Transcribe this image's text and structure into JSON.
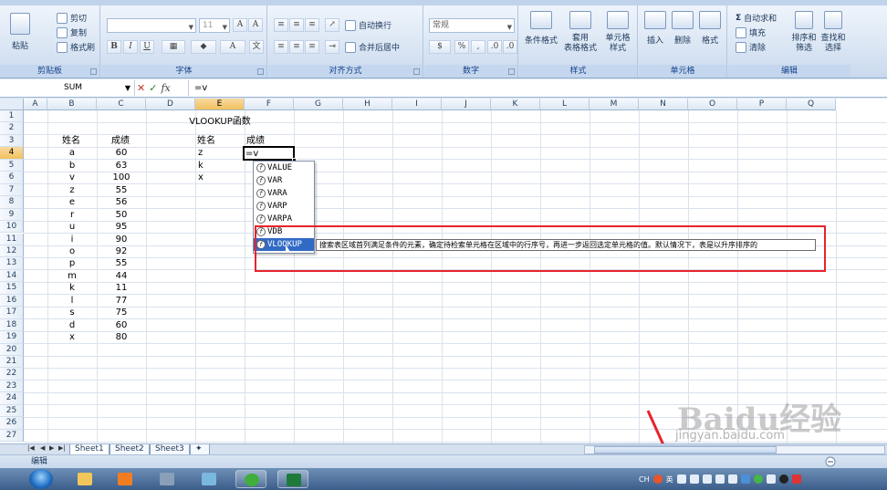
{
  "ribbon": {
    "clipboard": {
      "label": "剪贴板",
      "paste": "粘贴",
      "cut": "剪切",
      "copy": "复制",
      "format_painter": "格式刷"
    },
    "font": {
      "label": "字体",
      "size": "11",
      "bold": "B",
      "italic": "I",
      "underline": "U"
    },
    "alignment": {
      "label": "对齐方式",
      "wrap": "自动换行",
      "merge": "合并后居中"
    },
    "number": {
      "label": "数字",
      "format": "常规",
      "percent": "%"
    },
    "styles": {
      "label": "样式",
      "conditional": "条件格式",
      "table_format": "套用\n表格格式",
      "cell_styles": "单元格\n样式"
    },
    "cells": {
      "label": "单元格",
      "insert": "插入",
      "delete": "删除",
      "format": "格式"
    },
    "editing": {
      "label": "编辑",
      "autosum": "自动求和",
      "fill": "填充",
      "clear": "清除",
      "sort": "排序和\n筛选",
      "find": "查找和\n选择"
    }
  },
  "formula_bar": {
    "name_box": "SUM",
    "formula": "=v"
  },
  "columns": [
    "A",
    "B",
    "C",
    "D",
    "E",
    "F",
    "G",
    "H",
    "I",
    "J",
    "K",
    "L",
    "M",
    "N",
    "O",
    "P",
    "Q"
  ],
  "rows": [
    "1",
    "2",
    "3",
    "4",
    "5",
    "6",
    "7",
    "8",
    "9",
    "10",
    "11",
    "12",
    "13",
    "14",
    "15",
    "16",
    "17",
    "18",
    "19",
    "20",
    "21",
    "22",
    "23",
    "24",
    "25",
    "26",
    "27"
  ],
  "cells": {
    "title": "VLOOKUP函数",
    "header_name": "姓名",
    "header_score": "成绩",
    "lookup_header_name": "姓名",
    "lookup_header_score": "成绩",
    "active_input": "=v",
    "table": [
      {
        "name": "a",
        "score": "60"
      },
      {
        "name": "b",
        "score": "63"
      },
      {
        "name": "v",
        "score": "100"
      },
      {
        "name": "z",
        "score": "55"
      },
      {
        "name": "e",
        "score": "56"
      },
      {
        "name": "r",
        "score": "50"
      },
      {
        "name": "u",
        "score": "95"
      },
      {
        "name": "i",
        "score": "90"
      },
      {
        "name": "o",
        "score": "92"
      },
      {
        "name": "p",
        "score": "55"
      },
      {
        "name": "m",
        "score": "44"
      },
      {
        "name": "k",
        "score": "11"
      },
      {
        "name": "l",
        "score": "77"
      },
      {
        "name": "s",
        "score": "75"
      },
      {
        "name": "d",
        "score": "60"
      },
      {
        "name": "x",
        "score": "80"
      }
    ],
    "lookup_names": [
      "z",
      "k",
      "x"
    ]
  },
  "autocomplete": {
    "items": [
      "VALUE",
      "VAR",
      "VARA",
      "VARP",
      "VARPA",
      "VDB",
      "VLOOKUP"
    ],
    "selected": "VLOOKUP",
    "tooltip": "搜索表区域首列满足条件的元素，确定待检索单元格在区域中的行序号，再进一步返回选定单元格的值。默认情况下，表是以升序排序的"
  },
  "sheet_tabs": [
    "Sheet1",
    "Sheet2",
    "Sheet3"
  ],
  "status": {
    "mode": "编辑"
  },
  "watermark": {
    "brand": "Baidu经验",
    "url": "jingyan.baidu.com"
  },
  "tray": {
    "lang": "CH",
    "ime": "英"
  },
  "colors": {
    "accent_red": "#e8232b",
    "selection": "#316ac5",
    "ribbon": "#dbe6f4"
  }
}
